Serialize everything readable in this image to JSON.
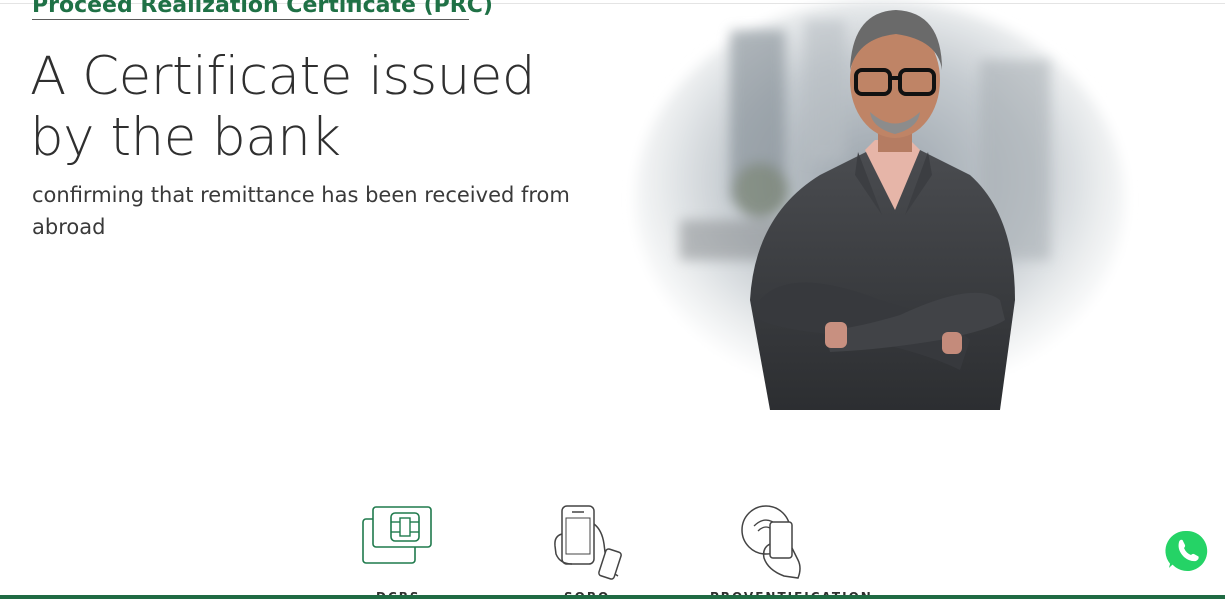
{
  "hero": {
    "eyebrow": "Proceed Realization Certificate (PRC)",
    "title": "A Certificate issued by the bank",
    "subtitle": "confirming that remittance has been received from abroad"
  },
  "features": [
    {
      "icon": "chip-card-icon",
      "label": "DCBS"
    },
    {
      "icon": "mobile-hand-icon",
      "label": "SOBO"
    },
    {
      "icon": "contactless-card-icon",
      "label": "PROVENTIFICATION"
    }
  ],
  "colors": {
    "brand_green": "#1f7146",
    "icon_green": "#1f7a4c",
    "whatsapp_green": "#25d366"
  },
  "whatsapp": {
    "icon": "whatsapp-icon"
  }
}
